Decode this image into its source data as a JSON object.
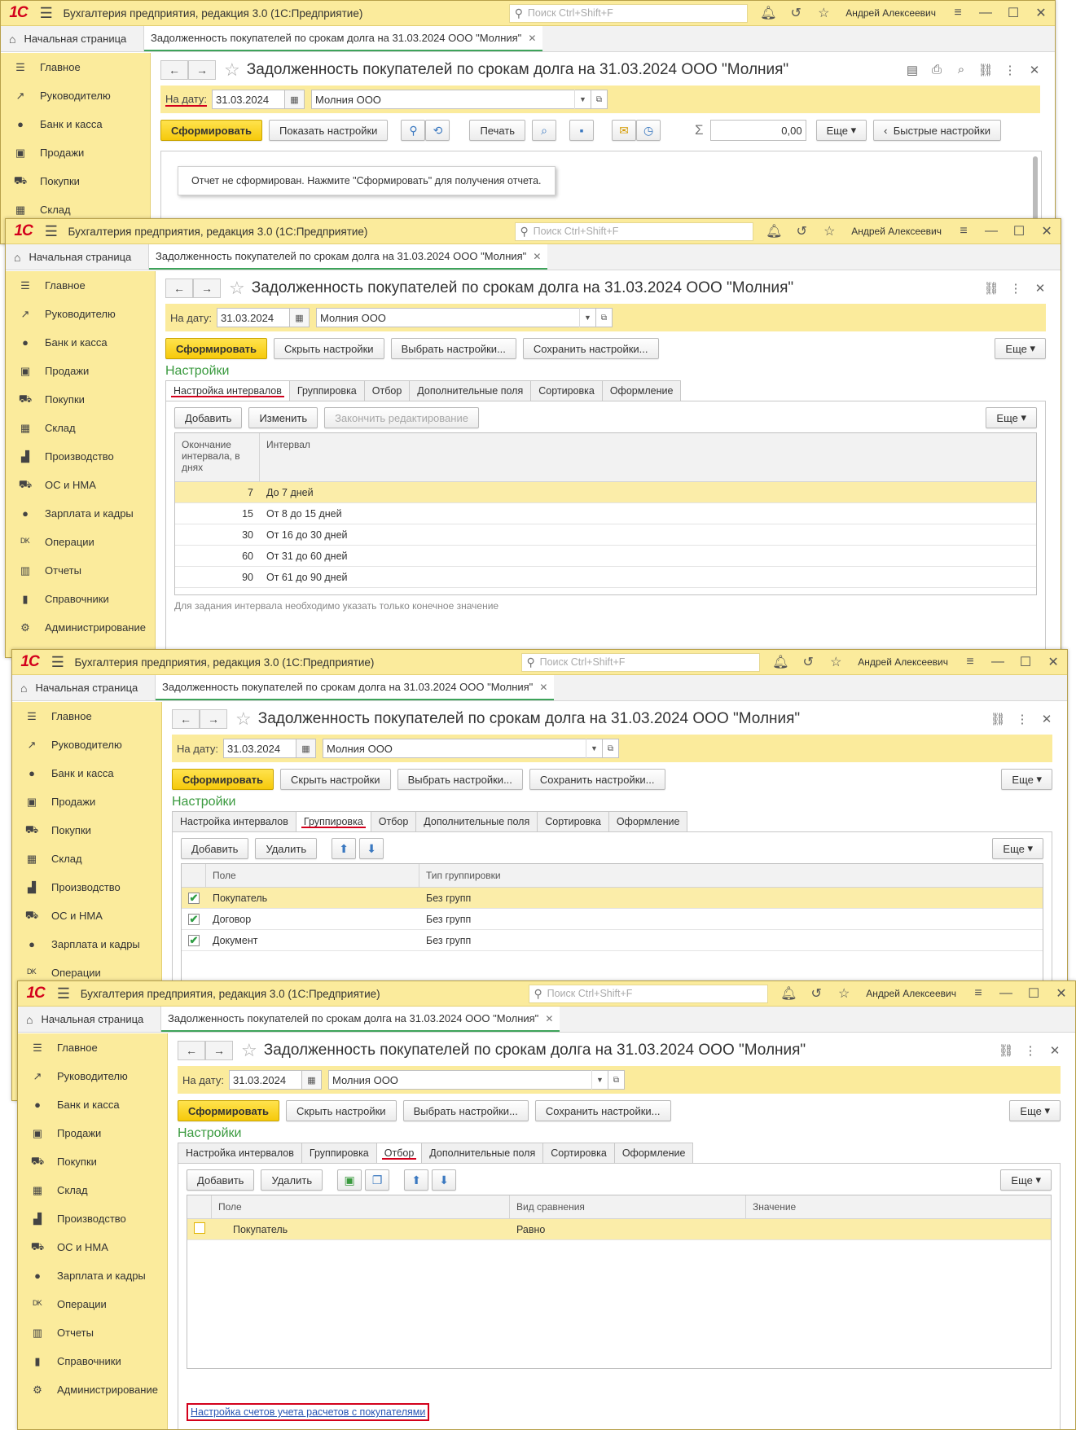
{
  "app": {
    "logo": "1С",
    "title": "Бухгалтерия предприятия, редакция 3.0  (1С:Предприятие)",
    "search_placeholder": "Поиск Ctrl+Shift+F",
    "user": "Андрей Алексеевич",
    "home_tab": "Начальная страница",
    "doc_tab": "Задолженность покупателей по срокам долга на 31.03.2024 ООО \"Молния\""
  },
  "sidebar": [
    "Главное",
    "Руководителю",
    "Банк и касса",
    "Продажи",
    "Покупки",
    "Склад",
    "Производство",
    "ОС и НМА",
    "Зарплата и кадры",
    "Операции",
    "Отчеты",
    "Справочники",
    "Администрирование"
  ],
  "form": {
    "title": "Задолженность покупателей по срокам долга на 31.03.2024 ООО \"Молния\"",
    "date_label": "На дату:",
    "date_value": "31.03.2024",
    "org_value": "Молния ООО",
    "generate": "Сформировать",
    "show_settings": "Показать настройки",
    "hide_settings": "Скрыть настройки",
    "choose_settings": "Выбрать настройки...",
    "save_settings": "Сохранить настройки...",
    "print": "Печать",
    "sum_value": "0,00",
    "more": "Еще",
    "quick_settings": "Быстрые настройки",
    "not_generated_msg": "Отчет не сформирован. Нажмите \"Сформировать\" для получения отчета.",
    "settings_title": "Настройки"
  },
  "settings_tabs": [
    "Настройка интервалов",
    "Группировка",
    "Отбор",
    "Дополнительные поля",
    "Сортировка",
    "Оформление"
  ],
  "intervals": {
    "add": "Добавить",
    "edit": "Изменить",
    "finish": "Закончить редактирование",
    "col_end": "Окончание интервала, в днях",
    "col_interval": "Интервал",
    "rows": [
      {
        "days": "7",
        "name": "До 7 дней"
      },
      {
        "days": "15",
        "name": "От 8 до 15 дней"
      },
      {
        "days": "30",
        "name": "От 16 до 30 дней"
      },
      {
        "days": "60",
        "name": "От 31 до 60 дней"
      },
      {
        "days": "90",
        "name": "От 61 до 90 дней"
      }
    ],
    "hint": "Для задания интервала необходимо указать только конечное значение"
  },
  "grouping": {
    "add": "Добавить",
    "delete": "Удалить",
    "col_field": "Поле",
    "col_type": "Тип группировки",
    "rows": [
      {
        "field": "Покупатель",
        "type": "Без групп"
      },
      {
        "field": "Договор",
        "type": "Без групп"
      },
      {
        "field": "Документ",
        "type": "Без групп"
      }
    ]
  },
  "filter": {
    "add": "Добавить",
    "delete": "Удалить",
    "col_field": "Поле",
    "col_compare": "Вид сравнения",
    "col_value": "Значение",
    "rows": [
      {
        "field": "Покупатель",
        "compare": "Равно",
        "value": ""
      }
    ],
    "link": "Настройка счетов учета расчетов с покупателями"
  },
  "colors": {
    "accent_yellow": "#fbeb9c",
    "red_mark": "#d3001c",
    "green_tab": "#3da35a"
  }
}
